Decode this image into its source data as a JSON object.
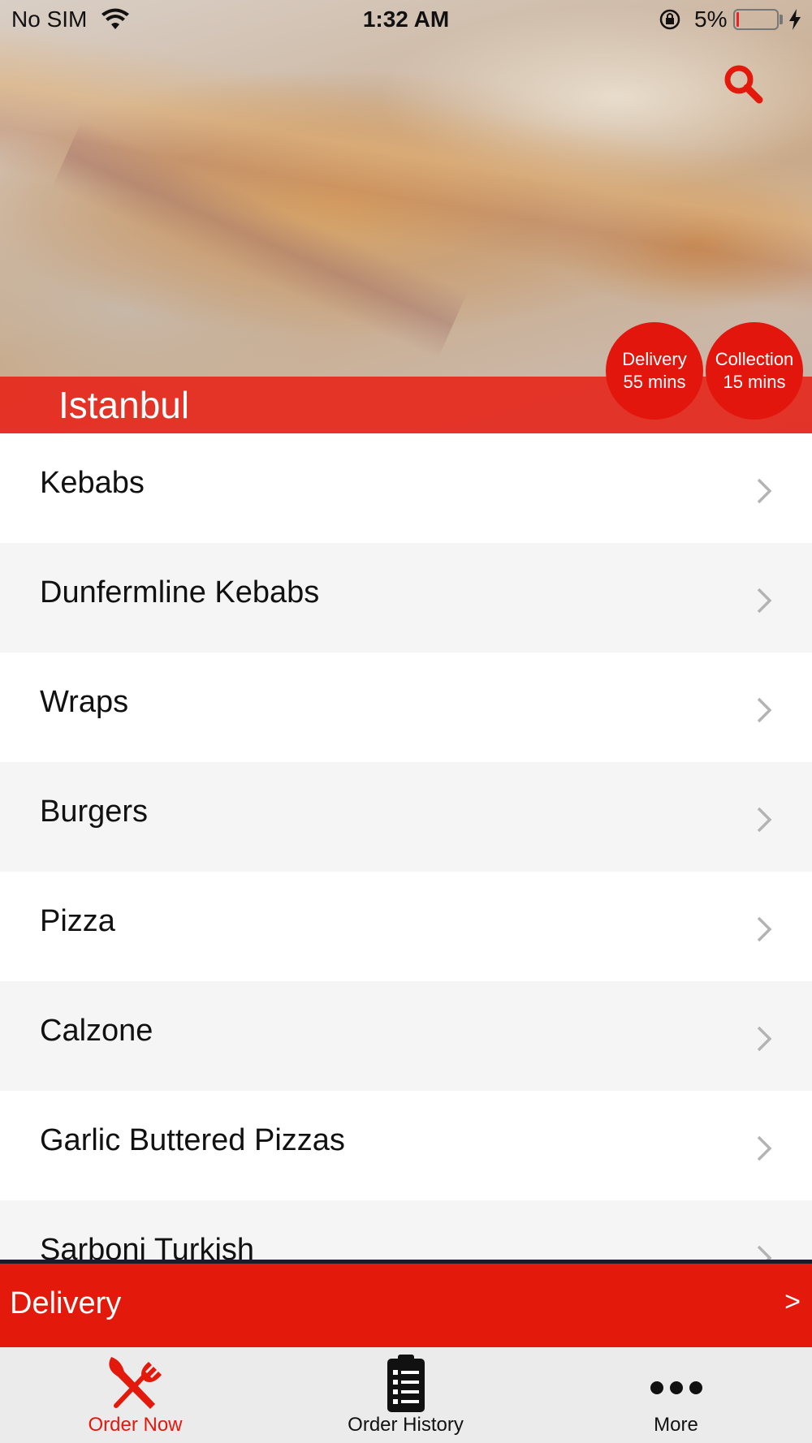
{
  "status_bar": {
    "carrier": "No SIM",
    "time": "1:32 AM",
    "battery_percent": "5%",
    "battery_level": 0.05,
    "icons": [
      "wifi-icon",
      "orientation-lock-icon",
      "battery-icon",
      "charging-bolt-icon"
    ]
  },
  "header": {
    "restaurant_name": "Istanbul",
    "search_icon": "search-icon",
    "accent_color": "#e3190b",
    "delivery_badge": {
      "line1": "Delivery",
      "line2": "55 mins"
    },
    "collection_badge": {
      "line1": "Collection",
      "line2": "15 mins"
    }
  },
  "menu": {
    "categories": [
      {
        "label": "Kebabs"
      },
      {
        "label": "Dunfermline Kebabs"
      },
      {
        "label": "Wraps"
      },
      {
        "label": "Burgers"
      },
      {
        "label": "Pizza"
      },
      {
        "label": "Calzone"
      },
      {
        "label": "Garlic Buttered Pizzas"
      },
      {
        "label": "Sarboni Turkish"
      }
    ],
    "chevron_icon": "chevron-right-icon"
  },
  "order_mode_bar": {
    "label": "Delivery",
    "arrow": ">"
  },
  "tab_bar": {
    "tabs": [
      {
        "label": "Order Now",
        "icon": "fork-knife-icon",
        "active": true
      },
      {
        "label": "Order History",
        "icon": "clipboard-list-icon",
        "active": false
      },
      {
        "label": "More",
        "icon": "more-dots-icon",
        "active": false
      }
    ]
  }
}
